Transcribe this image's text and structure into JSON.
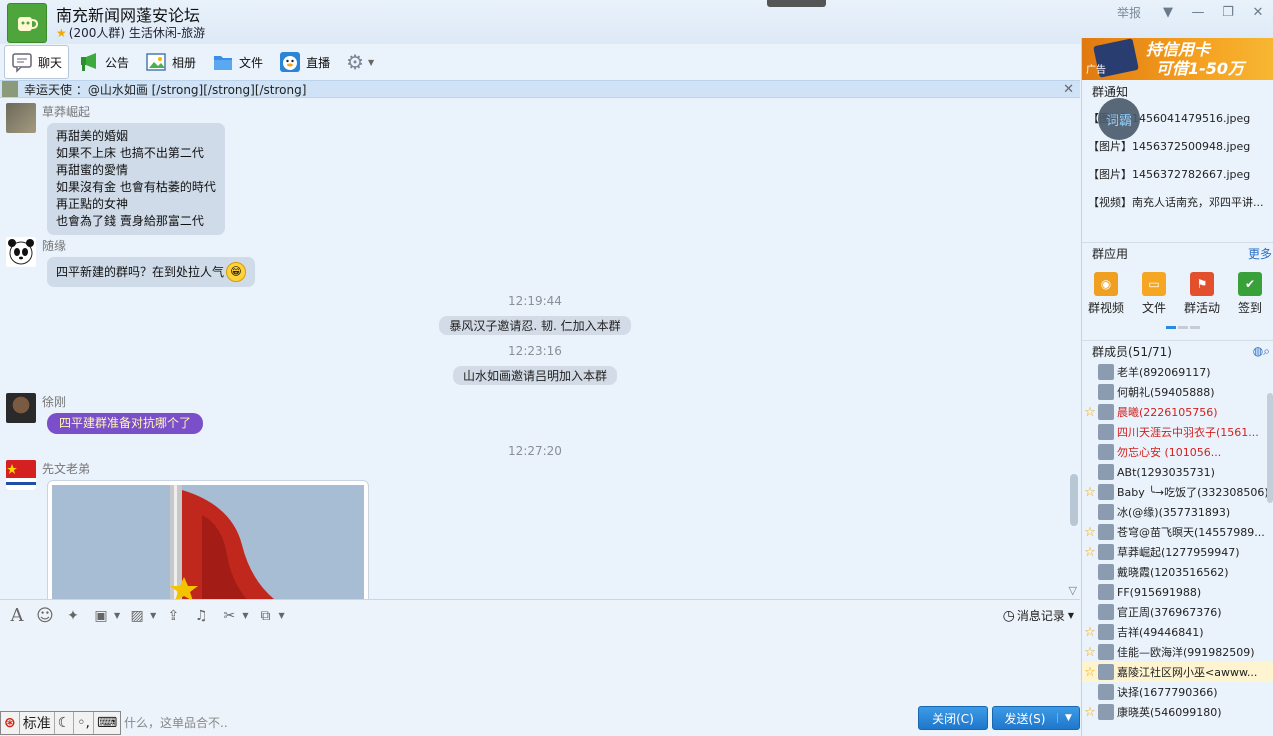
{
  "window": {
    "title": "南充新闻网蓬安论坛",
    "subtitle": "(200人群) 生活休闲-旅游",
    "report_label": "举报"
  },
  "toolbar": {
    "tabs": [
      {
        "label": "聊天"
      },
      {
        "label": "公告"
      },
      {
        "label": "相册"
      },
      {
        "label": "文件"
      },
      {
        "label": "直播"
      }
    ]
  },
  "announcement": {
    "text": "幸运天使 ：@山水如画 [/strong][/strong][/strong]"
  },
  "chat": {
    "messages": [
      {
        "nick": "草莽崛起",
        "lines": [
          "再甜美的婚姻",
          "如果不上床  也搞不出第二代",
          "再甜蜜的愛情",
          "如果沒有金  也會有枯萎的時代",
          "再正點的女神",
          "也會為了錢  賣身給那富二代"
        ]
      },
      {
        "nick": "随缘",
        "text": "四平新建的群吗？在到处拉人气"
      },
      {
        "nick": "徐刚",
        "text": "四平建群准备对抗哪个了"
      },
      {
        "nick": "先文老弟"
      }
    ],
    "timestamps": [
      "12:19:44",
      "12:23:16",
      "12:27:20"
    ],
    "system_notes": [
      "暴风汉子邀请忍. 韧. 仁加入本群",
      "山水如画邀请吕明加入本群"
    ]
  },
  "input": {
    "history_label": "消息记录",
    "hint": "什么，这单品合不..",
    "close_label": "关闭(C)",
    "send_label": "发送(S)",
    "ime": {
      "mode": "标准"
    }
  },
  "right": {
    "ad": {
      "label": "广告",
      "line1": "持信用卡",
      "line2": "可借1-50万"
    },
    "notice_header": "群通知",
    "float_badge": "词霸",
    "notices": [
      "【图片】1456041479516.jpeg",
      "【图片】1456372500948.jpeg",
      "【图片】1456372782667.jpeg",
      "【视频】南充人话南充，邓四平讲..."
    ],
    "apps_header": "群应用",
    "apps_more": "更多",
    "apps": [
      {
        "label": "群视频",
        "color": "#f0a020"
      },
      {
        "label": "文件",
        "color": "#f5a623"
      },
      {
        "label": "群活动",
        "color": "#e2502e"
      },
      {
        "label": "签到",
        "color": "#3aa03a"
      }
    ],
    "members_header": "群成员(51/71)",
    "members": [
      {
        "name": "老羊(892069117)",
        "star": false,
        "red": false
      },
      {
        "name": "何朝礼(59405888)",
        "star": false,
        "red": false
      },
      {
        "name": "晨曦(2226105756)",
        "star": true,
        "red": true
      },
      {
        "name": "四川天涯云中羽衣子(1561...",
        "star": false,
        "red": true
      },
      {
        "name": "勿忘心安          (101056...",
        "star": false,
        "red": true
      },
      {
        "name": "ABt(1293035731)",
        "star": false,
        "red": false
      },
      {
        "name": "Baby ╰→吃饭了(332308506)",
        "star": true,
        "red": false
      },
      {
        "name": "冰(@缘)(357731893)",
        "star": false,
        "red": false
      },
      {
        "name": "苍穹@苗飞暝天(14557989...",
        "star": true,
        "red": false
      },
      {
        "name": "草莽崛起(1277959947)",
        "star": true,
        "red": false
      },
      {
        "name": "戴晓霞(1203516562)",
        "star": false,
        "red": false
      },
      {
        "name": "FF(915691988)",
        "star": false,
        "red": false
      },
      {
        "name": "官正周(376967376)",
        "star": false,
        "red": false
      },
      {
        "name": "吉祥(49446841)",
        "star": true,
        "red": false
      },
      {
        "name": "佳能—欧海洋(991982509)",
        "star": true,
        "red": false
      },
      {
        "name": "嘉陵江社区网小巫<awww...",
        "star": true,
        "red": false,
        "highlight": true
      },
      {
        "name": "诀择(1677790366)",
        "star": false,
        "red": false
      },
      {
        "name": "康晓英(546099180)",
        "star": true,
        "red": false
      }
    ]
  },
  "colors": {
    "accent": "#1f77cc",
    "purple_bubble": "#7b4fc9",
    "red_name": "#d4201c"
  }
}
